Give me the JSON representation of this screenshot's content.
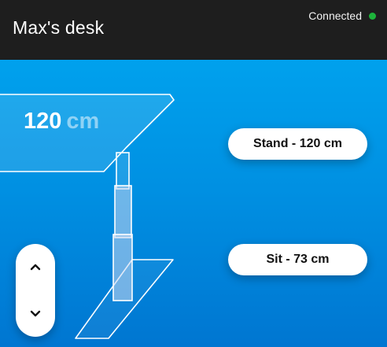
{
  "header": {
    "title": "Max's desk",
    "status_text": "Connected",
    "status_color": "#1db33a"
  },
  "desk": {
    "height_value": "120",
    "height_unit": "cm"
  },
  "presets": {
    "stand_label": "Stand - 120 cm",
    "sit_label": "Sit - 73 cm"
  },
  "controls": {
    "up_icon": "chevron-up-icon",
    "down_icon": "chevron-down-icon"
  },
  "colors": {
    "header_bg": "#1e1e1e",
    "accent_top": "#00a1ed",
    "accent_bottom": "#0076d1"
  }
}
